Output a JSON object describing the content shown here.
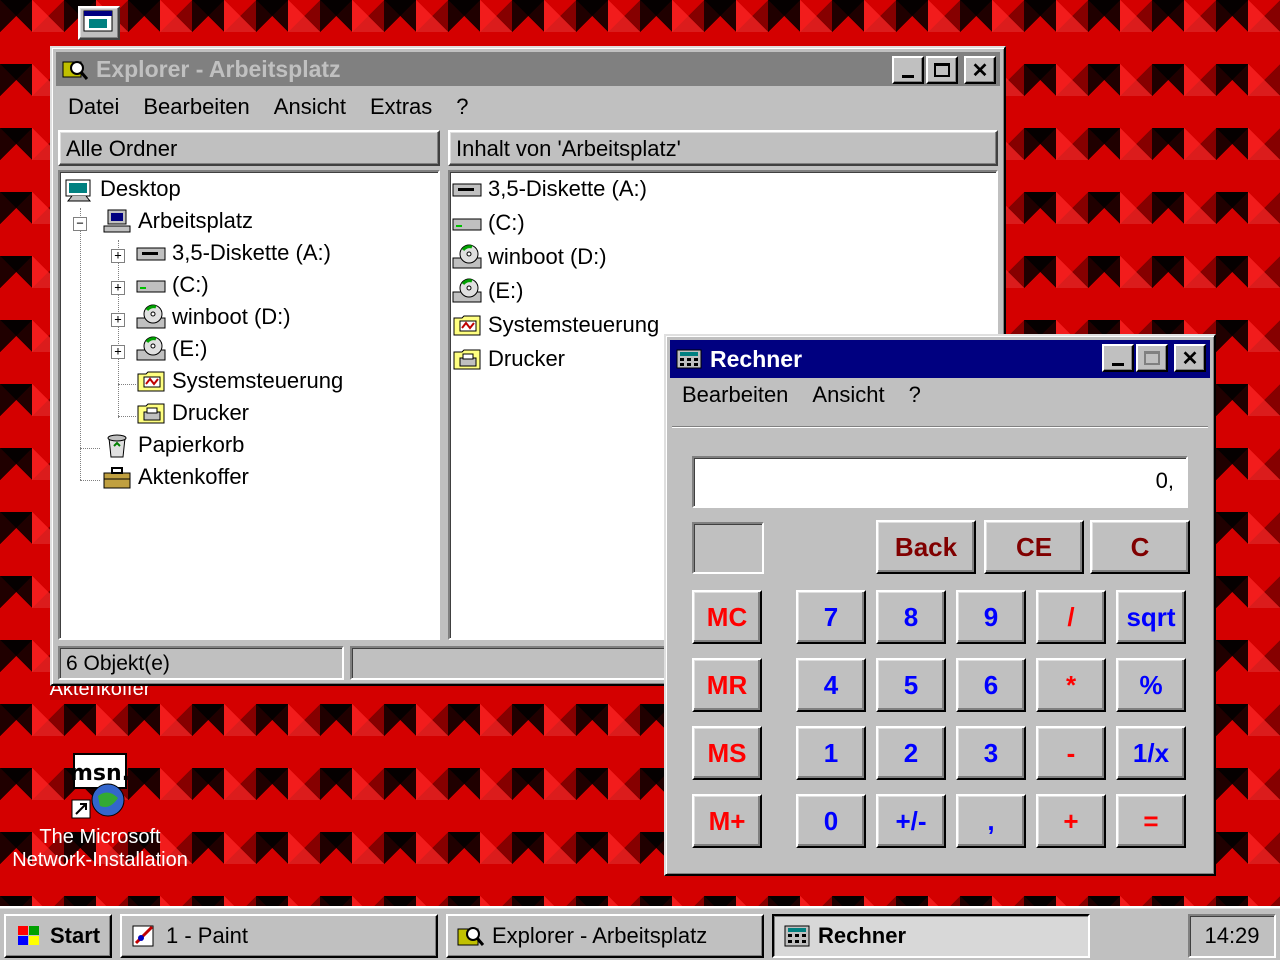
{
  "desktop": {
    "icons": [
      {
        "label_line1": "The Microsoft",
        "label_line2": "Network-Installation",
        "icon": "msn-icon"
      },
      {
        "label": "Aktenkoffer",
        "icon": "briefcase-icon"
      }
    ]
  },
  "explorer": {
    "title": "Explorer - Arbeitsplatz",
    "menu": [
      "Datei",
      "Bearbeiten",
      "Ansicht",
      "Extras",
      "?"
    ],
    "left_header": "Alle Ordner",
    "right_header": "Inhalt von 'Arbeitsplatz'",
    "tree": [
      {
        "label": "Desktop",
        "icon": "desktop-icon"
      },
      {
        "label": "Arbeitsplatz",
        "icon": "computer-icon"
      },
      {
        "label": "3,5-Diskette (A:)",
        "icon": "floppy-drive-icon"
      },
      {
        "label": "(C:)",
        "icon": "hard-drive-icon"
      },
      {
        "label": "winboot (D:)",
        "icon": "cd-drive-icon"
      },
      {
        "label": "(E:)",
        "icon": "cd-drive-icon"
      },
      {
        "label": "Systemsteuerung",
        "icon": "control-panel-icon"
      },
      {
        "label": "Drucker",
        "icon": "printer-folder-icon"
      },
      {
        "label": "Papierkorb",
        "icon": "recycle-bin-icon"
      },
      {
        "label": "Aktenkoffer",
        "icon": "briefcase-icon"
      }
    ],
    "contents": [
      {
        "label": "3,5-Diskette (A:)",
        "icon": "floppy-drive-icon"
      },
      {
        "label": "(C:)",
        "icon": "hard-drive-icon"
      },
      {
        "label": "winboot (D:)",
        "icon": "cd-drive-icon"
      },
      {
        "label": "(E:)",
        "icon": "cd-drive-icon"
      },
      {
        "label": "Systemsteuerung",
        "icon": "control-panel-icon"
      },
      {
        "label": "Drucker",
        "icon": "printer-folder-icon"
      }
    ],
    "status": "6 Objekt(e)"
  },
  "calculator": {
    "title": "Rechner",
    "menu": [
      "Bearbeiten",
      "Ansicht",
      "?"
    ],
    "display": "0,",
    "edit_buttons": [
      "Back",
      "CE",
      "C"
    ],
    "memory_buttons": [
      "MC",
      "MR",
      "MS",
      "M+"
    ],
    "rows": [
      [
        "7",
        "8",
        "9",
        "/",
        "sqrt"
      ],
      [
        "4",
        "5",
        "6",
        "*",
        "%"
      ],
      [
        "1",
        "2",
        "3",
        "-",
        "1/x"
      ],
      [
        "0",
        "+/-",
        ",",
        "+",
        "="
      ]
    ]
  },
  "taskbar": {
    "start": "Start",
    "items": [
      "1 - Paint",
      "Explorer - Arbeitsplatz",
      "Rechner"
    ],
    "clock": "14:29"
  },
  "colors": {
    "titlebar_active": "#000080",
    "titlebar_inactive": "#808080",
    "window_face": "#c0c0c0",
    "calc_red": "#ff0000",
    "calc_darkred": "#800000",
    "calc_blue": "#0000ff",
    "desktop_red": "#c00000"
  }
}
